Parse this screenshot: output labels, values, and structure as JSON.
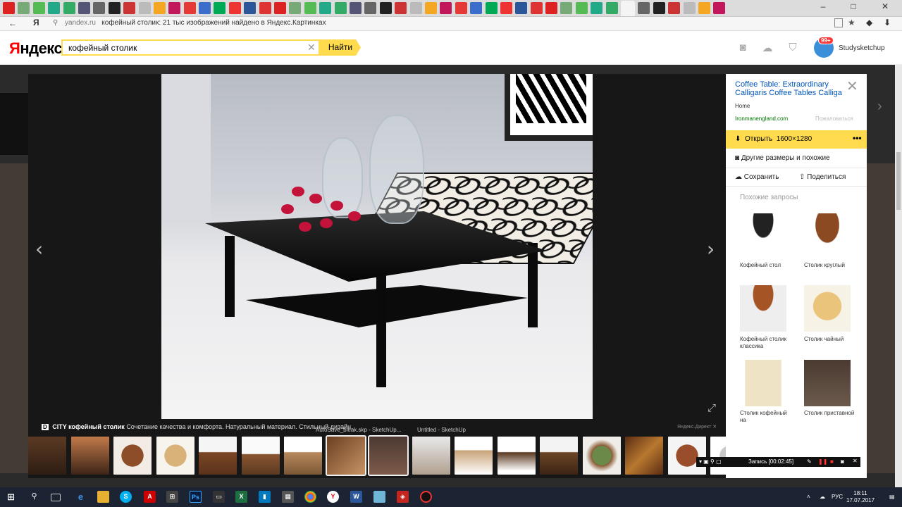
{
  "browser": {
    "tab_count": 48,
    "address_host": "yandex.ru",
    "address_title": "кофейный столик: 21 тыс изображений найдено в Яндекс.Картинках",
    "window_minimize": "–",
    "window_maximize": "□",
    "window_close": "✕"
  },
  "header": {
    "logo_first": "Я",
    "logo_rest": "ндекс",
    "search_value": "кофейный столик",
    "search_button": "Найти",
    "badge": "99+",
    "username": "Studysketchup"
  },
  "viewer": {
    "caption_ad_mark": "D",
    "caption_title": "CITY кофейный столик",
    "caption_text": "Сочетание качества и комфорта. Натуральный материал. Стильный дизайн.",
    "direct_label": "Яндекс.Директ",
    "ghost_label_1": "AutoSave_bleak.skp - SketchUp...",
    "ghost_label_2": "Untitled - SketchUp"
  },
  "panel": {
    "title": "Coffee Table: Extraordinary Calligaris Coffee Tables Calliga",
    "breadcrumb": "Home",
    "domain": "Ironmanengland.com",
    "complain": "Пожаловаться",
    "open_label": "Открыть",
    "open_size": "1600×1280",
    "more_sizes": "Другие размеры и похожие",
    "save": "Сохранить",
    "share": "Поделиться",
    "similar_heading": "Похожие запросы",
    "similar": [
      {
        "label": "Кофейный стол"
      },
      {
        "label": "Столик круглый"
      },
      {
        "label": "Кофейный столик классика"
      },
      {
        "label": "Столик чайный"
      },
      {
        "label": "Столик кофейный на"
      },
      {
        "label": "Столик приставной"
      }
    ]
  },
  "recorder": {
    "text": "Запись [00:02:45]"
  },
  "taskbar": {
    "lang": "РУС",
    "time": "18:11",
    "date": "17.07.2017"
  },
  "colors": {
    "yandex_yellow": "#ffdb4d",
    "link_blue": "#0055bb",
    "domain_green": "#007700"
  }
}
